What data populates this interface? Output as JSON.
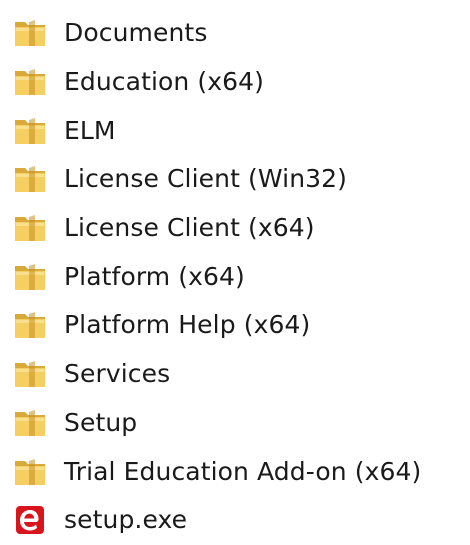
{
  "colors": {
    "folder_back": "#d9a93a",
    "folder_front": "#f6cf62",
    "folder_highlight": "#fbe39a",
    "exe_red": "#d8141c"
  },
  "items": [
    {
      "label": "Documents",
      "icon": "folder-icon"
    },
    {
      "label": "Education (x64)",
      "icon": "folder-icon"
    },
    {
      "label": "ELM",
      "icon": "folder-icon"
    },
    {
      "label": "License Client (Win32)",
      "icon": "folder-icon"
    },
    {
      "label": "License Client (x64)",
      "icon": "folder-icon"
    },
    {
      "label": "Platform (x64)",
      "icon": "folder-icon"
    },
    {
      "label": "Platform Help (x64)",
      "icon": "folder-icon"
    },
    {
      "label": "Services",
      "icon": "folder-icon"
    },
    {
      "label": "Setup",
      "icon": "folder-icon"
    },
    {
      "label": "Trial Education Add-on (x64)",
      "icon": "folder-icon"
    },
    {
      "label": "setup.exe",
      "icon": "exe-icon"
    }
  ]
}
